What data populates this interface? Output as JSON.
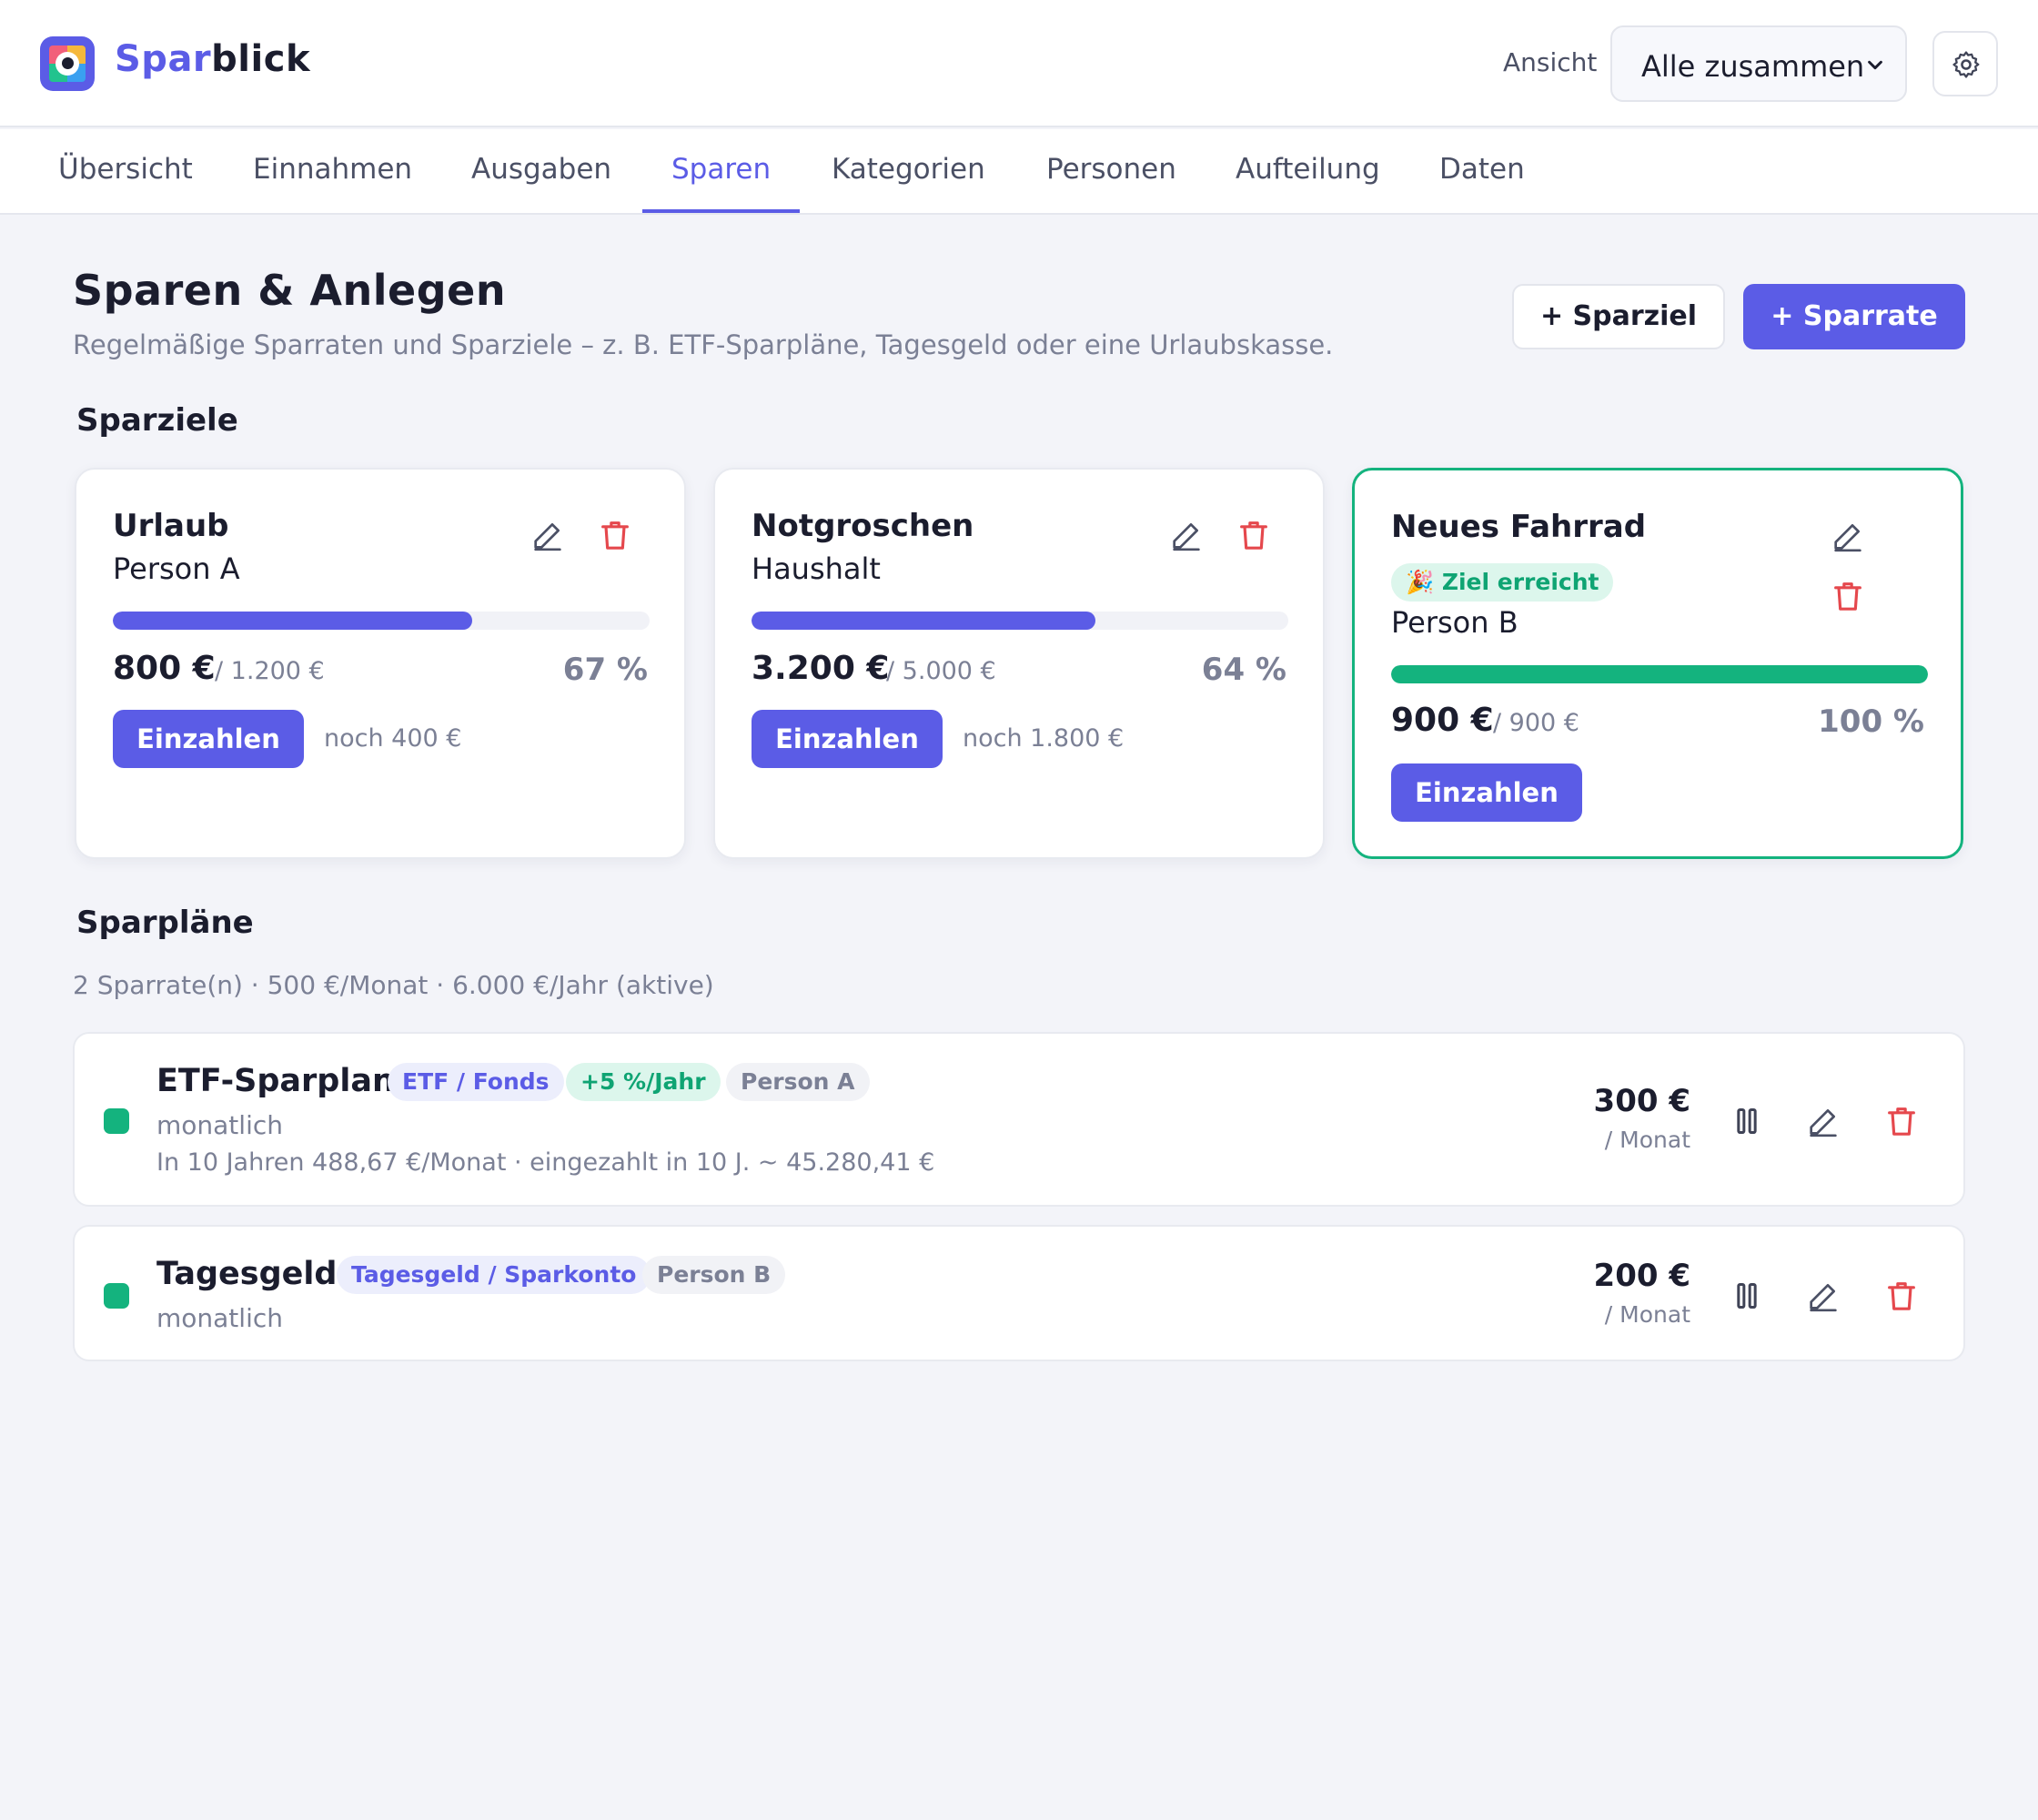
{
  "app": {
    "name_part1": "Spar",
    "name_part2": "blick"
  },
  "header": {
    "view_label": "Ansicht",
    "view_value": "Alle zusammen"
  },
  "tabs": [
    {
      "label": "Übersicht"
    },
    {
      "label": "Einnahmen"
    },
    {
      "label": "Ausgaben"
    },
    {
      "label": "Sparen",
      "active": true
    },
    {
      "label": "Kategorien"
    },
    {
      "label": "Personen"
    },
    {
      "label": "Aufteilung"
    },
    {
      "label": "Daten"
    }
  ],
  "page": {
    "title": "Sparen & Anlegen",
    "subtitle": "Regelmäßige Sparraten und Sparziele – z. B. ETF-Sparpläne, Tagesgeld oder eine Urlaubskasse.",
    "add_goal_label": "+ Sparziel",
    "add_rate_label": "+ Sparrate"
  },
  "goals_section": {
    "title": "Sparziele"
  },
  "goals": [
    {
      "name": "Urlaub",
      "owner": "Person A",
      "saved": "800 €",
      "target": "/ 1.200 €",
      "percent_label": "67 %",
      "progress": 0.67,
      "deposit_label": "Einzahlen",
      "remaining": "noch 400 €"
    },
    {
      "name": "Notgroschen",
      "owner": "Haushalt",
      "saved": "3.200 €",
      "target": "/ 5.000 €",
      "percent_label": "64 %",
      "progress": 0.64,
      "deposit_label": "Einzahlen",
      "remaining": "noch 1.800 €"
    },
    {
      "name": "Neues Fahrrad",
      "badge": "🎉 Ziel erreicht",
      "owner": "Person B",
      "saved": "900 €",
      "target": "/ 900 €",
      "percent_label": "100 %",
      "progress": 1.0,
      "deposit_label": "Einzahlen"
    }
  ],
  "plans_section": {
    "title": "Sparpläne",
    "summary": "2 Sparrate(n) · 500 €/Monat · 6.000 €/Jahr (aktive)"
  },
  "plans": [
    {
      "name": "ETF-Sparplan",
      "category": "ETF / Fonds",
      "return": "+5 %/Jahr",
      "person": "Person A",
      "frequency": "monatlich",
      "projection": "In 10 Jahren 488,67 €/Monat · eingezahlt in 10 J. ~ 45.280,41 €",
      "amount": "300 €",
      "unit": "/ Monat"
    },
    {
      "name": "Tagesgeld",
      "category": "Tagesgeld / Sparkonto",
      "person": "Person B",
      "frequency": "monatlich",
      "amount": "200 €",
      "unit": "/ Monat"
    }
  ],
  "colors": {
    "accent": "#5b5ce6",
    "success": "#14b37e",
    "danger": "#e5484d",
    "muted": "#7b8095"
  },
  "icons": {
    "edit": "pencil-icon",
    "delete": "trash-icon",
    "pause": "pause-icon",
    "settings": "gear-icon",
    "dropdown": "chevron-down-icon"
  }
}
